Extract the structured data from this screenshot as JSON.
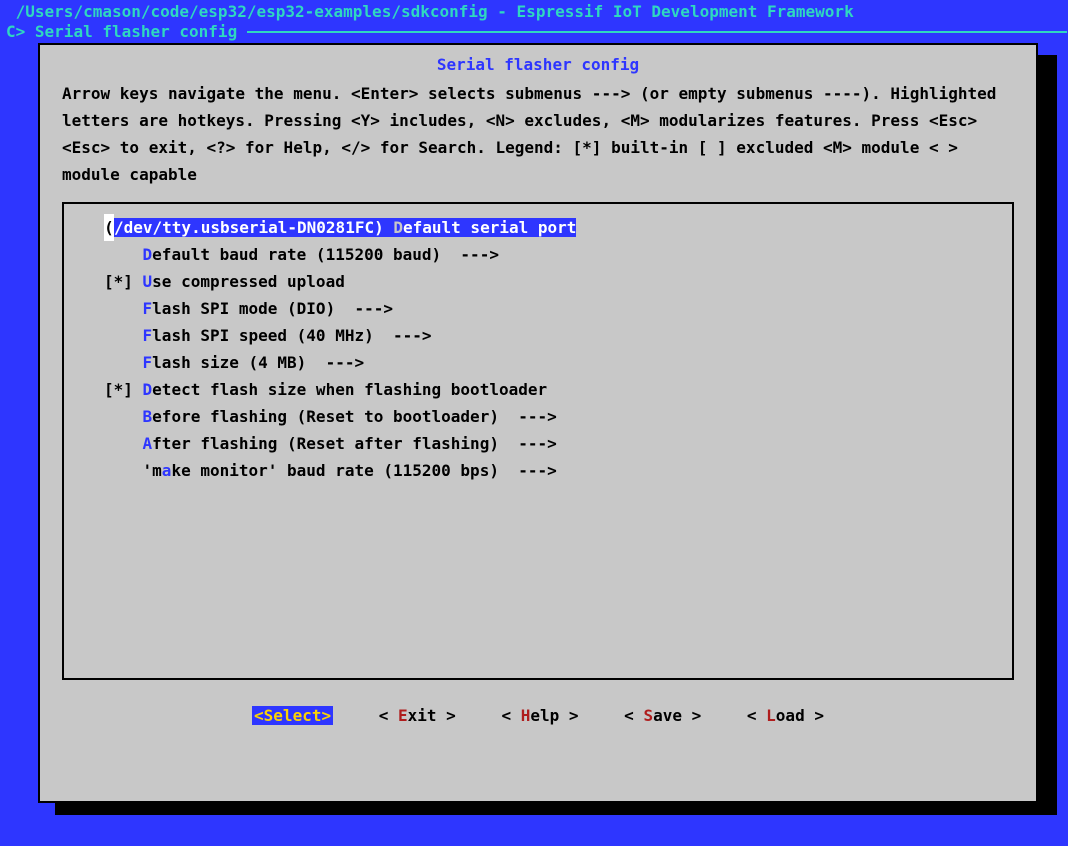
{
  "topbar": {
    "path": "/Users/cmason/code/esp32/esp32-examples/sdkconfig - Espressif IoT Development Framework",
    "indicator": "C>",
    "breadcrumb": "Serial flasher config"
  },
  "dialog": {
    "title": "Serial flasher config",
    "help": "Arrow keys navigate the menu.  <Enter> selects submenus ---> (or empty submenus ----).  Highlighted letters are hotkeys.  Pressing <Y> includes, <N> excludes, <M> modularizes features.  Press <Esc><Esc> to exit, <?> for Help, </> for Search.  Legend: [*] built-in  [ ] excluded  <M> module  < > module capable"
  },
  "menu": {
    "items": [
      {
        "prefix": "",
        "hot": "",
        "val": "/dev/tty.usbserial-DN0281FC",
        "labelHot": "D",
        "label": "efault serial port",
        "suffix": "",
        "selected": true
      },
      {
        "prefix": "    ",
        "hot": "D",
        "label": "efault baud rate (115200 baud)  --->",
        "selected": false
      },
      {
        "prefix": "[*] ",
        "hot": "U",
        "label": "se compressed upload",
        "selected": false
      },
      {
        "prefix": "    ",
        "hot": "F",
        "label": "lash SPI mode (DIO)  --->",
        "selected": false
      },
      {
        "prefix": "    ",
        "hot": "F",
        "label": "lash SPI speed (40 MHz)  --->",
        "selected": false
      },
      {
        "prefix": "    ",
        "hot": "F",
        "label": "lash size (4 MB)  --->",
        "selected": false
      },
      {
        "prefix": "[*] ",
        "hot": "D",
        "label": "etect flash size when flashing bootloader",
        "selected": false
      },
      {
        "prefix": "    ",
        "hot": "B",
        "label": "efore flashing (Reset to bootloader)  --->",
        "selected": false
      },
      {
        "prefix": "    ",
        "hot": "A",
        "label": "fter flashing (Reset after flashing)  --->",
        "selected": false
      },
      {
        "prefix": "    'm",
        "hot": "a",
        "label": "ke monitor' baud rate (115200 bps)  --->",
        "selected": false
      }
    ]
  },
  "buttons": {
    "select": "<Select>",
    "exit_l": "< ",
    "exit_h": "E",
    "exit_r": "xit >",
    "help_l": "< ",
    "help_h": "H",
    "help_r": "elp >",
    "save_l": "< ",
    "save_h": "S",
    "save_r": "ave >",
    "load_l": "< ",
    "load_h": "L",
    "load_r": "oad >"
  }
}
